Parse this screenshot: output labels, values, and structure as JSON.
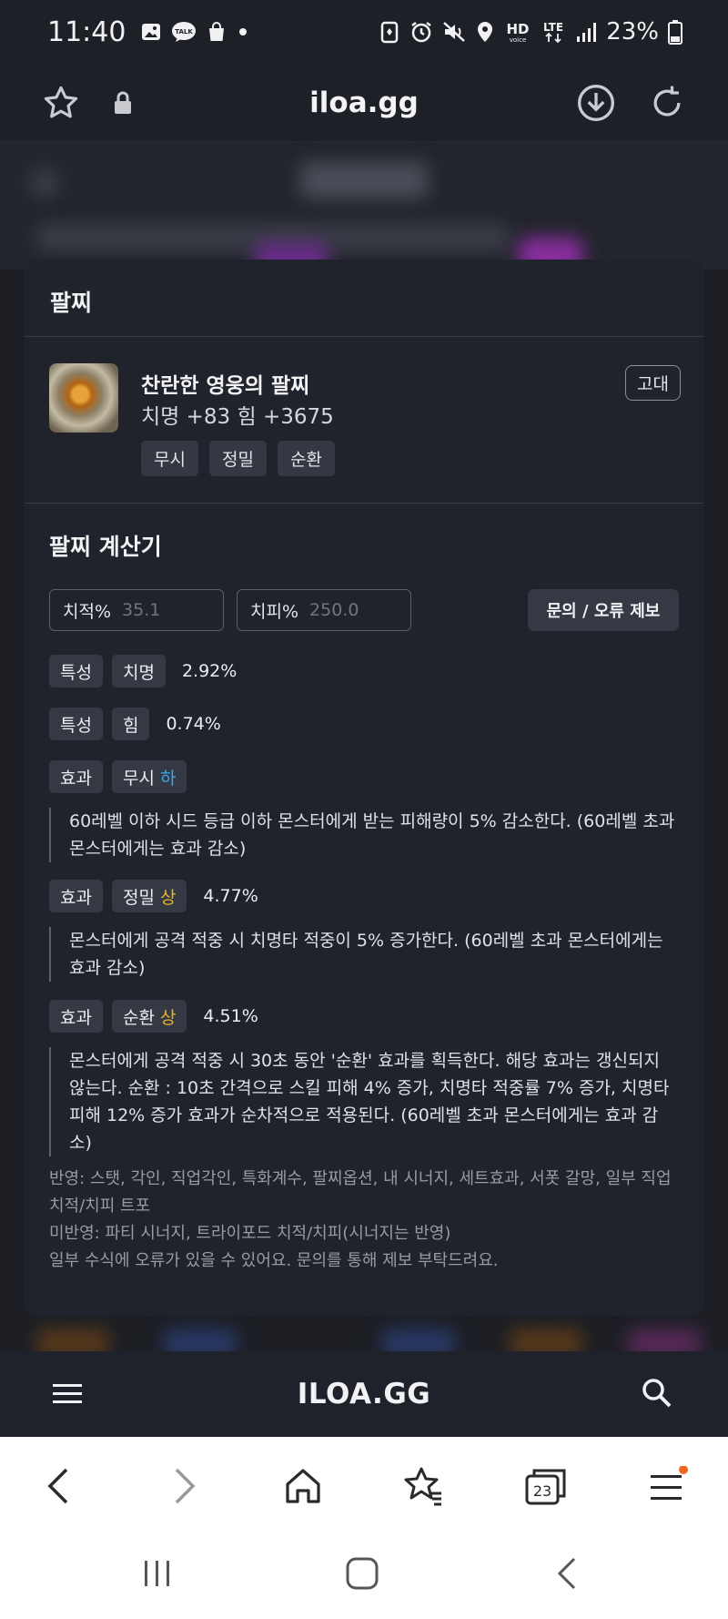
{
  "status_bar": {
    "time": "11:40",
    "battery": "23%",
    "left_icons": [
      "gallery-icon",
      "talk-icon",
      "shopping-bag-icon",
      "dot-icon"
    ],
    "right_icons": [
      "battery-saver-icon",
      "alarm-icon",
      "mute-icon",
      "location-icon",
      "hd-voice-icon",
      "lte-icon",
      "signal-icon",
      "battery-icon"
    ]
  },
  "browser": {
    "url": "iloa.gg"
  },
  "section": {
    "title": "팔찌"
  },
  "item": {
    "name": "찬란한 영웅의 팔찌",
    "stats": "치명 +83  힘 +3675",
    "grade": "고대",
    "tags": [
      "무시",
      "정밀",
      "순환"
    ]
  },
  "calculator": {
    "title": "팔찌 계산기",
    "crit_rate_label": "치적%",
    "crit_rate_placeholder": "35.1",
    "crit_dmg_label": "치피%",
    "crit_dmg_placeholder": "250.0",
    "report_button": "문의 / 오류 제보"
  },
  "results": [
    {
      "kind": "특성",
      "stat": "치명",
      "tier": "",
      "value": "2.92%",
      "desc": ""
    },
    {
      "kind": "특성",
      "stat": "힘",
      "tier": "",
      "value": "0.74%",
      "desc": ""
    },
    {
      "kind": "효과",
      "stat": "무시",
      "tier": "하",
      "value": "",
      "desc": "60레벨 이하 시드 등급 이하 몬스터에게 받는 피해량이 5% 감소한다. (60레벨 초과 몬스터에게는 효과 감소)"
    },
    {
      "kind": "효과",
      "stat": "정밀",
      "tier": "상",
      "value": "4.77%",
      "desc": "몬스터에게 공격 적중 시 치명타 적중이 5% 증가한다. (60레벨 초과 몬스터에게는 효과 감소)"
    },
    {
      "kind": "효과",
      "stat": "순환",
      "tier": "상",
      "value": "4.51%",
      "desc": "몬스터에게 공격 적중 시 30초 동안 '순환' 효과를 획득한다. 해당 효과는 갱신되지 않는다. 순환 : 10초 간격으로 스킬 피해 4% 증가, 치명타 적중률 7% 증가, 치명타 피해 12% 증가 효과가 순차적으로 적용된다. (60레벨 초과 몬스터에게는 효과 감소)"
    }
  ],
  "notes": {
    "line1": "반영: 스탯, 각인, 직업각인, 특화계수, 팔찌옵션, 내 시너지, 세트효과, 서폿 갈망, 일부 직업 치적/치피 트포",
    "line2": "미반영: 파티 시너지, 트라이포드 치적/치피(시너지는 반영)",
    "line3": "일부 수식에 오류가 있을 수 있어요. 문의를 통해 제보 부탁드려요."
  },
  "site_nav": {
    "logo": "ILOA.GG"
  },
  "browser_bottom": {
    "tab_count": "23"
  },
  "colors": {
    "background": "#1c1e24",
    "card": "#20232b",
    "chip": "#353944",
    "tier_low": "#3aa8ec",
    "tier_high": "#e9b42c",
    "notification_dot": "#f26522"
  }
}
